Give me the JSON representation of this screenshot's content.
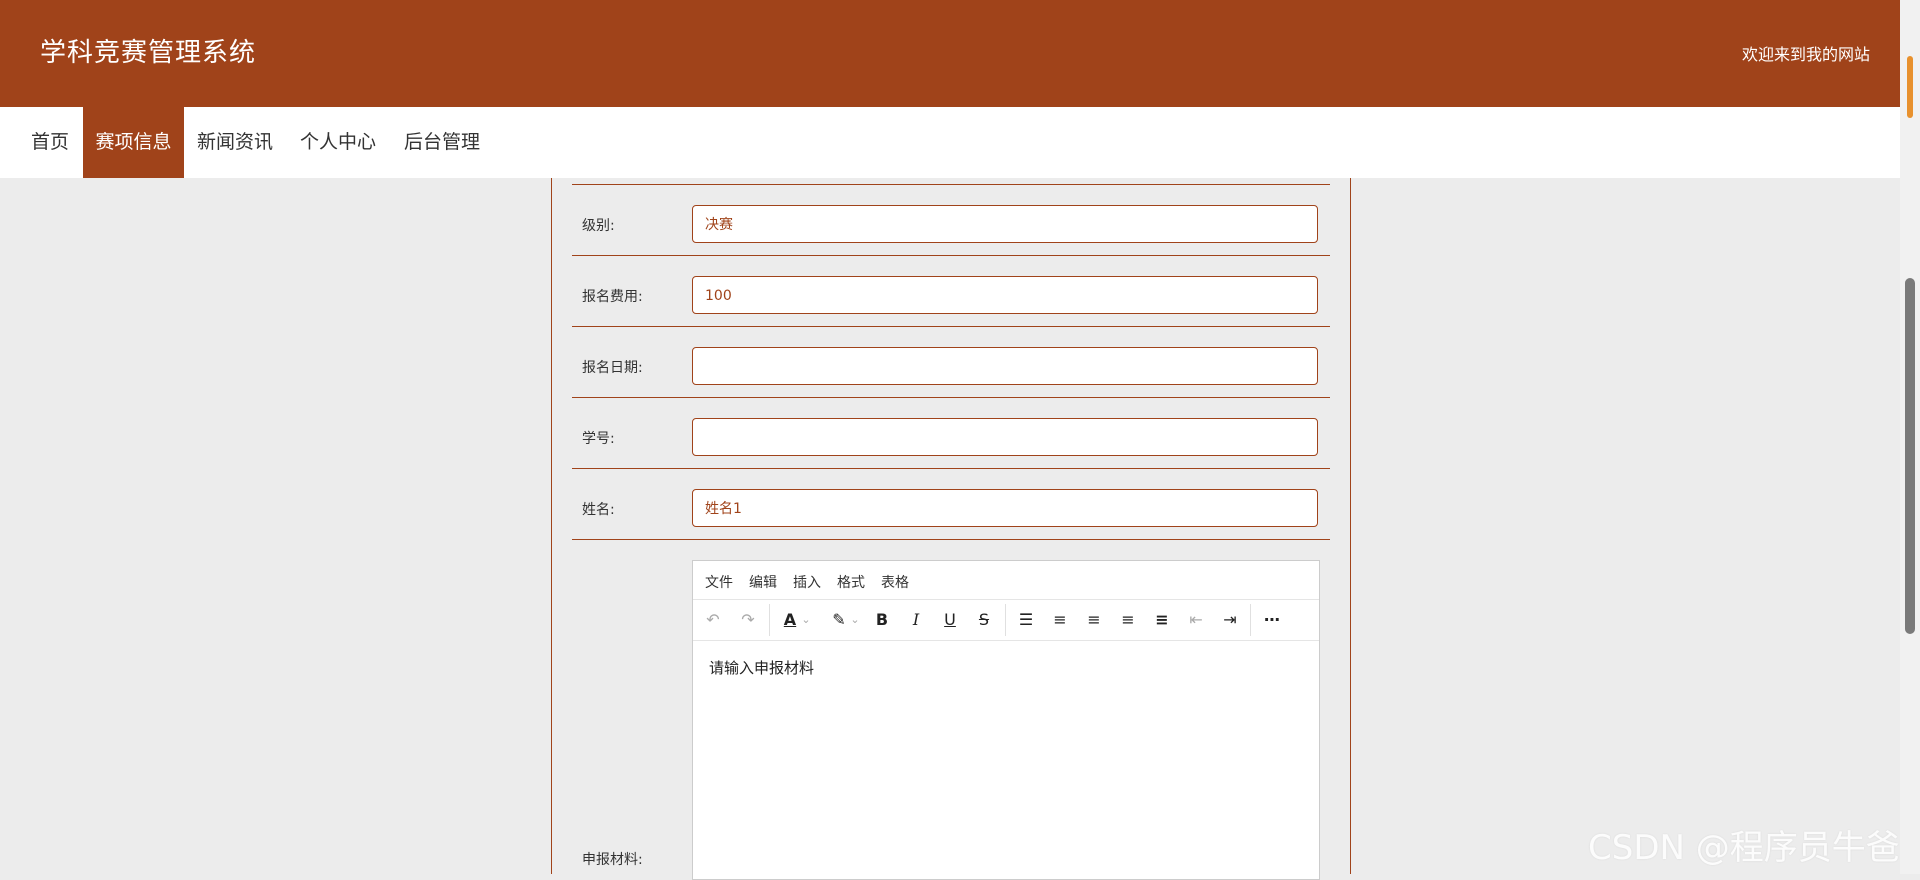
{
  "header": {
    "site_title": "学科竞赛管理系统",
    "welcome": "欢迎来到我的网站"
  },
  "nav": {
    "items": [
      "首页",
      "赛项信息",
      "新闻资讯",
      "个人中心",
      "后台管理"
    ],
    "active_index": 1
  },
  "form": {
    "level": {
      "label": "级别:",
      "value": "决赛"
    },
    "fee": {
      "label": "报名费用:",
      "value": "100"
    },
    "date": {
      "label": "报名日期:",
      "value": ""
    },
    "student_id": {
      "label": "学号:",
      "value": ""
    },
    "name": {
      "label": "姓名:",
      "value": "姓名1"
    },
    "material": {
      "label": "申报材料:",
      "editor_menu": [
        "文件",
        "编辑",
        "插入",
        "格式",
        "表格"
      ],
      "content": "请输入申报材料"
    }
  },
  "watermark": "CSDN @程序员牛爸",
  "colors": {
    "brand": "#a0431a",
    "background": "#ececec"
  },
  "toolbar_icons": [
    "undo-icon",
    "redo-icon",
    "text-color-icon",
    "highlight-icon",
    "bold-icon",
    "italic-icon",
    "underline-icon",
    "strikethrough-icon",
    "line-height-icon",
    "align-left-icon",
    "align-center-icon",
    "align-right-icon",
    "align-justify-icon",
    "outdent-icon",
    "indent-icon",
    "more-icon"
  ]
}
